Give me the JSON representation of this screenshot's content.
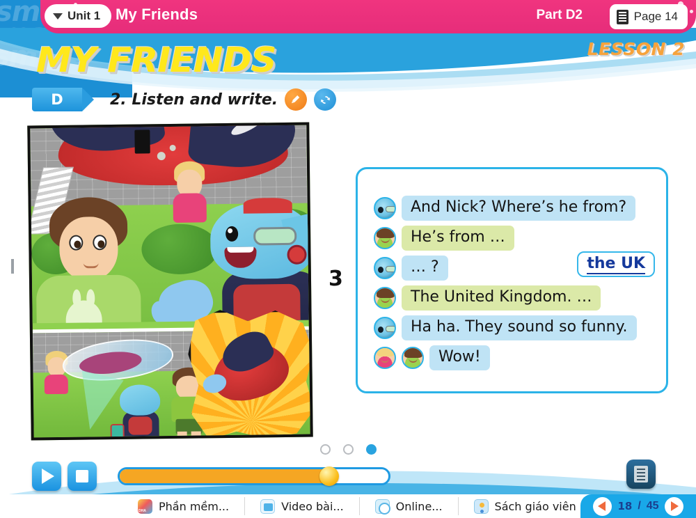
{
  "header": {
    "unit_chip_label": "Unit 1",
    "title": "My Friends",
    "part_label": "Part D2",
    "page_chip_label": "Page 14",
    "caret_icon": "chevron-down-icon",
    "book_icon": "book-icon",
    "collapse_icon": "chevron-up-icon",
    "accent_color": "#f0347f"
  },
  "page": {
    "title": "MY FRIENDS",
    "lesson_label": "LESSON 2",
    "title_color": "#ffe81c",
    "lesson_color": "#f6a33c",
    "background_watermark": "smart"
  },
  "task": {
    "tag_letter": "D",
    "instruction": "2. Listen and write.",
    "pencil_icon": "pencil-icon",
    "refresh_icon": "refresh-icon",
    "tag_color": "#2a9cdf"
  },
  "exercise": {
    "number": "3",
    "dialogue": [
      {
        "speaker": "robot",
        "text": "And Nick? Where’s he from?",
        "style": "blue"
      },
      {
        "speaker": "boy",
        "text": "He’s from …",
        "style": "green"
      },
      {
        "speaker": "robot",
        "text": "… ?",
        "style": "blue"
      },
      {
        "speaker": "boy",
        "text": "The United Kingdom. …",
        "style": "green"
      },
      {
        "speaker": "robot",
        "text": "Ha ha. They sound so funny.",
        "style": "blue"
      },
      {
        "speaker": "kid+boy",
        "text": "Wow!",
        "style": "blue"
      }
    ],
    "answer": "the UK",
    "answer_color": "#15399c"
  },
  "carousel": {
    "dots": 3,
    "active_index": 2,
    "active_color": "#29a3e0"
  },
  "media": {
    "play_icon": "play-icon",
    "stop_icon": "stop-icon",
    "progress_percent": 78,
    "script_icon": "script-icon"
  },
  "nav": {
    "prev_icon": "chevron-left-icon"
  },
  "taskbar": {
    "items": [
      {
        "label": "Phần mềm...",
        "icon": "software-icon"
      },
      {
        "label": "Video bài...",
        "icon": "video-icon"
      },
      {
        "label": "Online...",
        "icon": "online-icon"
      },
      {
        "label": "Sách giáo viên",
        "icon": "teacher-book-icon"
      }
    ],
    "pager": {
      "current": "18",
      "separator": "/",
      "total": "45",
      "prev_icon": "triangle-left-icon",
      "next_icon": "triangle-right-icon",
      "background": "#19a8e8"
    }
  }
}
